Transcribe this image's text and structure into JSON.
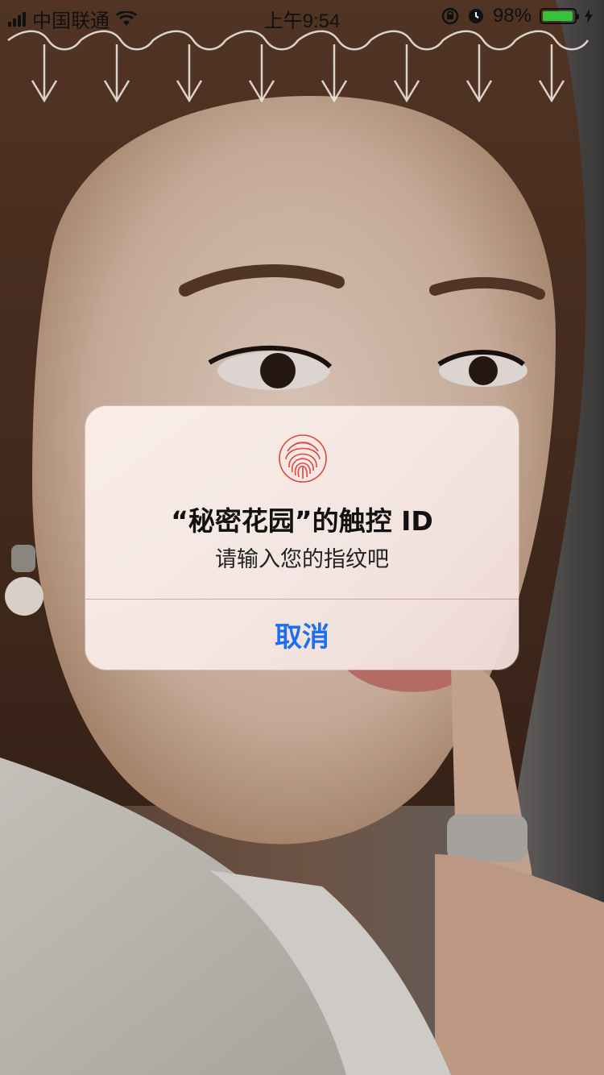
{
  "status_bar": {
    "carrier": "中国联通",
    "time": "上午9:54",
    "battery_percent": "98%",
    "battery_level": 0.98
  },
  "alert": {
    "title": "“秘密花园”的触控 ID",
    "message": "请输入您的指纹吧",
    "cancel_label": "取消",
    "icon": "fingerprint-icon"
  },
  "colors": {
    "accent": "#1d6ff2",
    "battery": "#38c23a",
    "fingerprint": "#e2463c"
  }
}
